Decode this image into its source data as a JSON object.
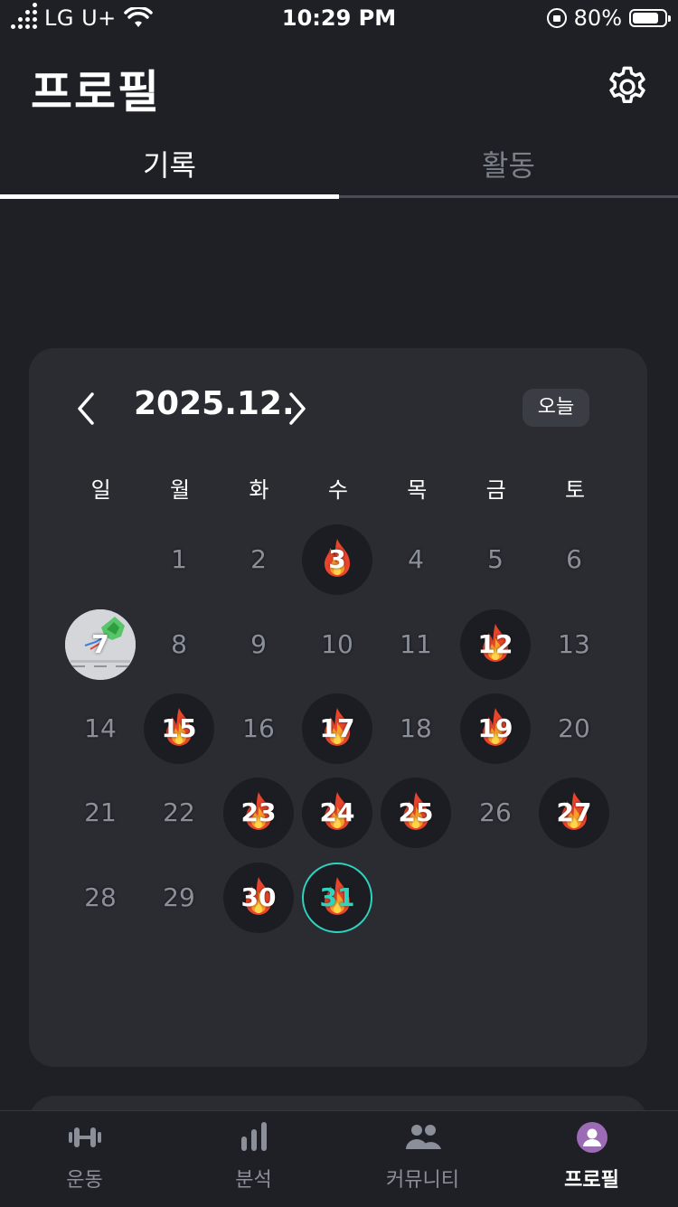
{
  "status_bar": {
    "carrier": "LG U+",
    "time": "10:29 PM",
    "battery": "80%",
    "battery_level": 0.8
  },
  "header": {
    "title": "프로필",
    "settings_icon": "gear-icon"
  },
  "tabs": [
    {
      "label": "기록",
      "active": true
    },
    {
      "label": "활동",
      "active": false
    }
  ],
  "calendar": {
    "month_label": "2025.12.",
    "today_button": "오늘",
    "weekdays": [
      "일",
      "월",
      "화",
      "수",
      "목",
      "금",
      "토"
    ],
    "days": [
      {
        "day": "1",
        "state": "none"
      },
      {
        "day": "2",
        "state": "none"
      },
      {
        "day": "3",
        "state": "fire"
      },
      {
        "day": "4",
        "state": "none"
      },
      {
        "day": "5",
        "state": "none"
      },
      {
        "day": "6",
        "state": "none"
      },
      {
        "day": "7",
        "state": "photo"
      },
      {
        "day": "8",
        "state": "none"
      },
      {
        "day": "9",
        "state": "none"
      },
      {
        "day": "10",
        "state": "none"
      },
      {
        "day": "11",
        "state": "none"
      },
      {
        "day": "12",
        "state": "fire"
      },
      {
        "day": "13",
        "state": "none"
      },
      {
        "day": "14",
        "state": "none"
      },
      {
        "day": "15",
        "state": "fire"
      },
      {
        "day": "16",
        "state": "none"
      },
      {
        "day": "17",
        "state": "fire"
      },
      {
        "day": "18",
        "state": "none"
      },
      {
        "day": "19",
        "state": "fire"
      },
      {
        "day": "20",
        "state": "none"
      },
      {
        "day": "21",
        "state": "none"
      },
      {
        "day": "22",
        "state": "none"
      },
      {
        "day": "23",
        "state": "fire"
      },
      {
        "day": "24",
        "state": "fire"
      },
      {
        "day": "25",
        "state": "fire"
      },
      {
        "day": "26",
        "state": "none"
      },
      {
        "day": "27",
        "state": "fire"
      },
      {
        "day": "28",
        "state": "none"
      },
      {
        "day": "29",
        "state": "none"
      },
      {
        "day": "30",
        "state": "fire"
      },
      {
        "day": "31",
        "state": "fire-today"
      }
    ],
    "today_color": "#2dd4bf"
  },
  "bottom_nav": [
    {
      "label": "운동",
      "icon": "dumbbell-icon",
      "active": false
    },
    {
      "label": "분석",
      "icon": "bar-chart-icon",
      "active": false
    },
    {
      "label": "커뮤니티",
      "icon": "people-icon",
      "active": false
    },
    {
      "label": "프로필",
      "icon": "profile-icon",
      "active": true
    }
  ]
}
